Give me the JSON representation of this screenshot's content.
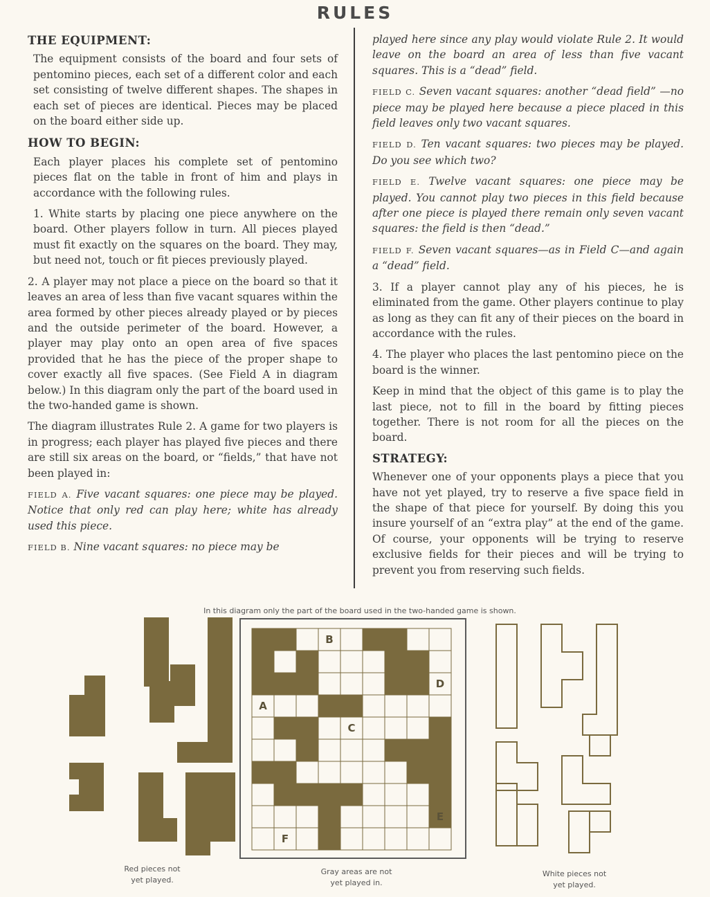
{
  "title": "RULES",
  "left": {
    "equipment_heading": "THE EQUIPMENT:",
    "equipment_text": "The equipment consists of the board and four sets of pentomino pieces, each set of a different color and each set consisting of twelve different shapes. The shapes in each set of pieces are identical. Pieces may be placed on the board either side up.",
    "begin_heading": "HOW TO BEGIN:",
    "begin_text": "Each player places his complete set of pentomino pieces flat on the table in front of him and plays in accordance with the following rules.",
    "rule1": "1. White starts by placing one piece anywhere on the board. Other players follow in turn. All pieces played must fit exactly on the squares on the board. They may, but need not, touch or fit pieces previously played.",
    "rule2": "2. A player may not place a piece on the board so that it leaves an area of less than five vacant squares within the area formed by other pieces already played or by pieces and the outside perimeter of the board. However, a player may play onto an open area of five spaces provided that he has the piece of the proper shape to cover exactly all five spaces. (See Field A in diagram below.) In this diagram only the part of the board used in the two-handed game is shown.",
    "diagram_text": "The diagram illustrates Rule 2. A game for two players is in progress; each player has played five pieces and there are still six areas on the board, or “fields,” that have not been played in:",
    "field_a_tag": "FIELD A.",
    "field_a_text": "Five vacant squares: one piece may be played. Notice that only red can play here; white has already used this piece.",
    "field_b_tag": "FIELD B.",
    "field_b_text": "Nine vacant squares: no piece may be"
  },
  "right": {
    "field_b_cont": "played here since any play would violate Rule 2. It would leave on the board an area of less than five vacant squares. This is a “dead” field.",
    "field_c_tag": "FIELD C.",
    "field_c_text": "Seven vacant squares: another “dead field” —no piece may be played here because a piece placed in this field leaves only two vacant squares.",
    "field_d_tag": "FIELD D.",
    "field_d_text": "Ten vacant squares: two pieces may be played. Do you see which two?",
    "field_e_tag": "FIELD E.",
    "field_e_text": "Twelve vacant squares: one piece may be played. You cannot play two pieces in this field because after one piece is played there remain only seven vacant squares: the field is then “dead.”",
    "field_f_tag": "FIELD F.",
    "field_f_text": "Seven vacant squares—as in Field C—and again a “dead” field.",
    "rule3": "3. If a player cannot play any of his pieces, he is eliminated from the game. Other players continue to play as long as they can fit any of their pieces on the board in accordance with the rules.",
    "rule4": "4. The player who places the last pentomino piece on the board is the winner.",
    "keep_in_mind": "Keep in mind that the object of this game is to play the last piece, not to fill in the board by fitting pieces together. There is not room for all the pieces on the board.",
    "strategy_heading": "STRATEGY:",
    "strategy_text": "Whenever one of your opponents plays a piece that you have not yet played, try to reserve a five space field in the shape of that piece for yourself. By doing this you insure yourself of an “extra play” at the end of the game. Of course, your opponents will be trying to reserve exclusive fields for their pieces and will be trying to prevent you from reserving such fields."
  },
  "diagram": {
    "caption_top": "In this diagram only the part of the board used in the two-handed game is shown.",
    "caption_red_1": "Red pieces not",
    "caption_red_2": "yet played.",
    "caption_gray_1": "Gray areas are not",
    "caption_gray_2": "yet played in.",
    "caption_white_1": "White pieces not",
    "caption_white_2": "yet played.",
    "field_labels": [
      "A",
      "B",
      "C",
      "D",
      "E",
      "F"
    ]
  },
  "colors": {
    "piece": "#7a6a3e",
    "board_line": "#7a6a3e",
    "text": "#3c3c3c"
  }
}
